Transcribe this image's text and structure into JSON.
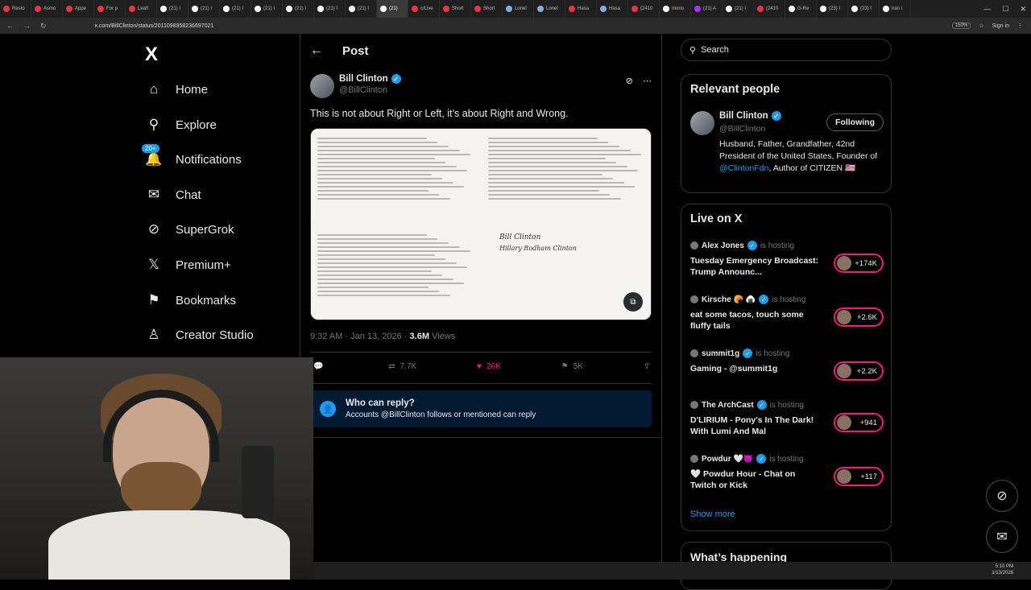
{
  "browser": {
    "tabs": [
      {
        "label": "Resto",
        "color": "#e34"
      },
      {
        "label": "Asmo",
        "color": "#e34"
      },
      {
        "label": "Appe",
        "color": "#e34"
      },
      {
        "label": "For p",
        "color": "#e34"
      },
      {
        "label": "Leafl",
        "color": "#e34"
      },
      {
        "label": "(21) I",
        "color": "#fff"
      },
      {
        "label": "(21) I",
        "color": "#fff"
      },
      {
        "label": "(21) I",
        "color": "#fff"
      },
      {
        "label": "(21) I",
        "color": "#fff"
      },
      {
        "label": "(21) I",
        "color": "#fff"
      },
      {
        "label": "(21) I",
        "color": "#fff"
      },
      {
        "label": "(21) I",
        "color": "#fff"
      },
      {
        "label": "(21)",
        "color": "#fff"
      },
      {
        "label": "c/Live",
        "color": "#e34"
      },
      {
        "label": "Short",
        "color": "#e34"
      },
      {
        "label": "Short",
        "color": "#e34"
      },
      {
        "label": "Lonel",
        "color": "#8ad"
      },
      {
        "label": "Lonel",
        "color": "#8ad"
      },
      {
        "label": "Hasa",
        "color": "#e34"
      },
      {
        "label": "Hasa",
        "color": "#8ad"
      },
      {
        "label": "(2410",
        "color": "#e34"
      },
      {
        "label": "mono",
        "color": "#fff"
      },
      {
        "label": "(21) A",
        "color": "#a3f"
      },
      {
        "label": "(21) I",
        "color": "#fff"
      },
      {
        "label": "(2410",
        "color": "#e34"
      },
      {
        "label": "G-Re",
        "color": "#fff"
      },
      {
        "label": "(23) I",
        "color": "#fff"
      },
      {
        "label": "(23) I",
        "color": "#fff"
      },
      {
        "label": "iran i",
        "color": "#fff"
      }
    ],
    "active_tab_index": 12,
    "url": "x.com/BillClinton/status/2011098958236697021",
    "zoom": "150%",
    "sign_in": "Sign in"
  },
  "nav": {
    "logo": "X",
    "items": [
      {
        "label": "Home",
        "icon": "home-icon",
        "glyph": "⌂"
      },
      {
        "label": "Explore",
        "icon": "search-icon",
        "glyph": "⚲"
      },
      {
        "label": "Notifications",
        "icon": "bell-icon",
        "glyph": "🔔",
        "badge": "20+"
      },
      {
        "label": "Chat",
        "icon": "mail-icon",
        "glyph": "✉"
      },
      {
        "label": "SuperGrok",
        "icon": "grok-icon",
        "glyph": "⊘"
      },
      {
        "label": "Premium+",
        "icon": "x-icon",
        "glyph": "𝕏"
      },
      {
        "label": "Bookmarks",
        "icon": "bookmark-icon",
        "glyph": "⚑"
      },
      {
        "label": "Creator Studio",
        "icon": "creator-icon",
        "glyph": "♙"
      }
    ]
  },
  "post": {
    "header_title": "Post",
    "author_name": "Bill Clinton",
    "author_handle": "@BillClinton",
    "text": "This is not about Right or Left, it’s about Right and Wrong.",
    "timestamp": "9:32 AM · Jan 13, 2026 · ",
    "views_count": "3.6M",
    "views_label": " Views",
    "stats": {
      "replies": "",
      "reposts": "7.7K",
      "likes": "26K",
      "bookmarks": "5K"
    },
    "who_can_reply_title": "Who can reply?",
    "who_can_reply_sub": "Accounts @BillClinton follows or mentioned can reply",
    "letter_signatures": [
      "Bill Clinton",
      "Hillary Rodham Clinton"
    ]
  },
  "sidebar": {
    "search_placeholder": "Search",
    "relevant_title": "Relevant people",
    "relevant": {
      "name": "Bill Clinton",
      "handle": "@BillClinton",
      "follow_label": "Following",
      "bio_pre": "Husband, Father, Grandfather, 42nd President of the United States, Founder of ",
      "bio_link": "@ClintonFdn",
      "bio_post": ", Author of CITIZEN 🇺🇸"
    },
    "live_title": "Live on X",
    "hosting_label": "is hosting",
    "live": [
      {
        "host": "Alex Jones",
        "title": "Tuesday Emergency Broadcast: Trump Announc...",
        "count": "+174K"
      },
      {
        "host": "Kirsche 🥐 🍙",
        "title": "eat some tacos, touch some fluffy tails",
        "count": "+2.6K"
      },
      {
        "host": "summit1g",
        "title": "Gaming - @summit1g",
        "count": "+2.2K"
      },
      {
        "host": "The ArchCast",
        "title": "D'LIRIUM - Pony's In The Dark! With Lumi And Mal",
        "count": "+941"
      },
      {
        "host": "Powdur 🤍😈",
        "title": "🤍 Powdur Hour - Chat on Twitch or Kick",
        "count": "+117"
      }
    ],
    "show_more": "Show more",
    "whats_happening": "What’s happening"
  },
  "taskbar": {
    "time": "5:10 PM",
    "date": "1/13/2026"
  }
}
